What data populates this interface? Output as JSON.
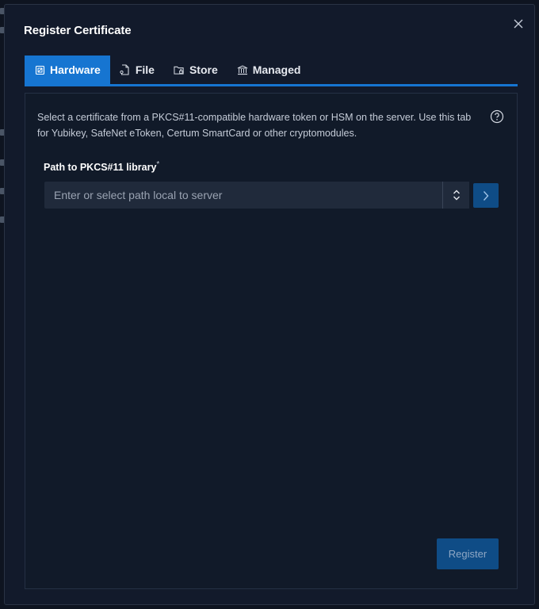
{
  "dialog": {
    "title": "Register Certificate",
    "close_icon": "close-icon"
  },
  "tabs": [
    {
      "label": "Hardware",
      "icon": "chip-icon",
      "active": true
    },
    {
      "label": "File",
      "icon": "file-key-icon",
      "active": false
    },
    {
      "label": "Store",
      "icon": "folder-lock-icon",
      "active": false
    },
    {
      "label": "Managed",
      "icon": "bank-icon",
      "active": false
    }
  ],
  "hardware": {
    "description": "Select a certificate from a PKCS#11-compatible hardware token or HSM on the server. Use this tab for Yubikey, SafeNet eToken, Certum SmartCard or other cryptomodules.",
    "help_icon": "help-circle-icon",
    "path_label": "Path to PKCS#11 library",
    "required_mark": "*",
    "path_value": "",
    "path_placeholder": "Enter or select path local to server"
  },
  "actions": {
    "register_label": "Register"
  },
  "colors": {
    "accent": "#1675d1",
    "button_dark": "#0f4c86",
    "background": "#121a2b"
  }
}
